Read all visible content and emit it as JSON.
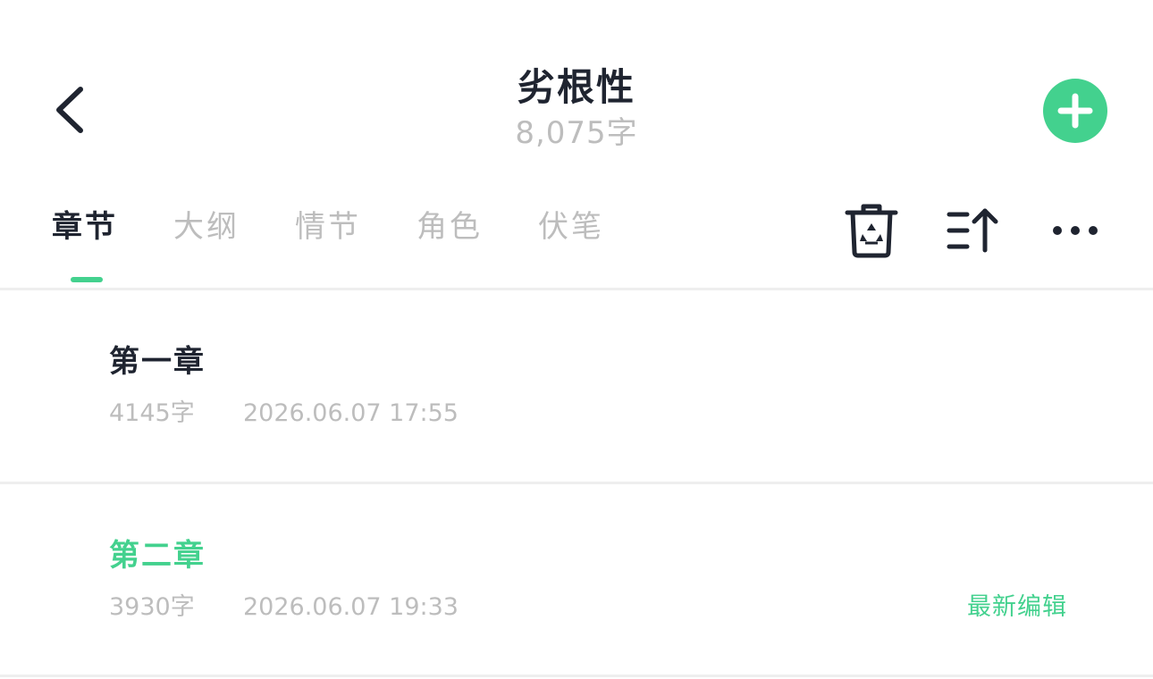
{
  "header": {
    "back_icon": "chevron-left-icon",
    "title": "劣根性",
    "word_count": "8,075字",
    "add_icon": "plus-circle-icon",
    "accent_color": "#43d18e"
  },
  "tabs": [
    {
      "label": "章节",
      "active": true
    },
    {
      "label": "大纲",
      "active": false
    },
    {
      "label": "情节",
      "active": false
    },
    {
      "label": "角色",
      "active": false
    },
    {
      "label": "伏笔",
      "active": false
    }
  ],
  "toolbar": {
    "icons": [
      "recycle-bin-icon",
      "sort-ascending-icon",
      "more-options-icon"
    ]
  },
  "chapters": [
    {
      "title": "第一章",
      "word_count": "4145字",
      "timestamp": "2026.06.07 17:55",
      "badge": ""
    },
    {
      "title": "第二章",
      "word_count": "3930字",
      "timestamp": "2026.06.07 19:33",
      "badge": "最新编辑"
    }
  ]
}
